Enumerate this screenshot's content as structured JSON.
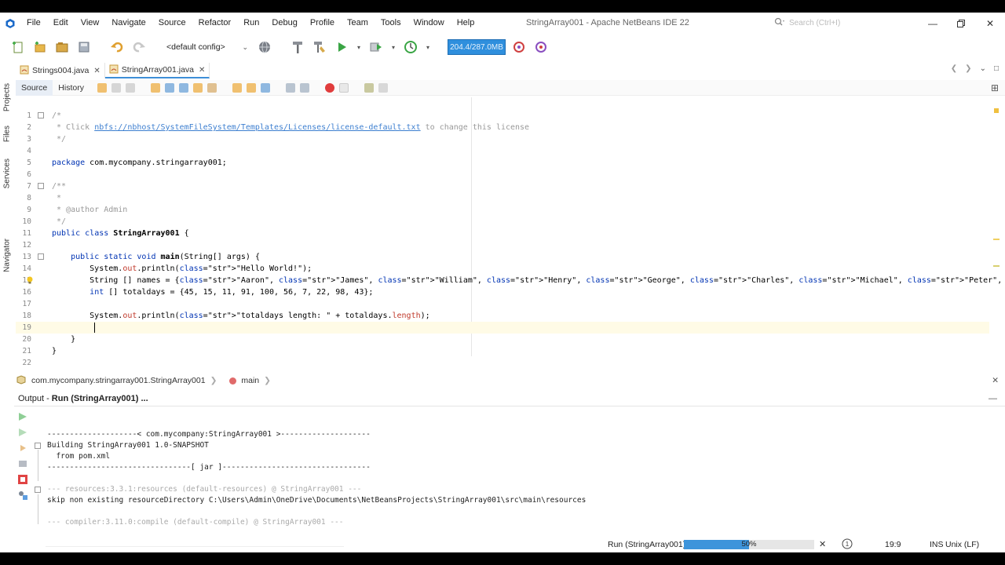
{
  "window": {
    "title": "StringArray001 - Apache NetBeans IDE 22"
  },
  "menu": [
    "File",
    "Edit",
    "View",
    "Navigate",
    "Source",
    "Refactor",
    "Run",
    "Debug",
    "Profile",
    "Team",
    "Tools",
    "Window",
    "Help"
  ],
  "search": {
    "placeholder": "Search (Ctrl+I)"
  },
  "toolbar": {
    "config": "<default config>",
    "memory": "204.4/287.0MB"
  },
  "side_panels": [
    "Projects",
    "Files",
    "Services",
    "Navigator"
  ],
  "tabs": [
    {
      "label": "Strings004.java",
      "active": false
    },
    {
      "label": "StringArray001.java",
      "active": true
    }
  ],
  "source_bar": {
    "source": "Source",
    "history": "History"
  },
  "code": [
    {
      "n": "1",
      "t": "/*"
    },
    {
      "n": "2",
      "t": " * Click nbfs://nbhost/SystemFileSystem/Templates/Licenses/license-default.txt to change this license"
    },
    {
      "n": "3",
      "t": " */"
    },
    {
      "n": "4",
      "t": ""
    },
    {
      "n": "5",
      "t": "package com.mycompany.stringarray001;"
    },
    {
      "n": "6",
      "t": ""
    },
    {
      "n": "7",
      "t": "/**"
    },
    {
      "n": "8",
      "t": " *"
    },
    {
      "n": "9",
      "t": " * @author Admin"
    },
    {
      "n": "10",
      "t": " */"
    },
    {
      "n": "11",
      "t": "public class StringArray001 {"
    },
    {
      "n": "12",
      "t": ""
    },
    {
      "n": "13",
      "t": "    public static void main(String[] args) {"
    },
    {
      "n": "14",
      "t": "        System.out.println(\"Hello World!\");"
    },
    {
      "n": "15",
      "t": "        String [] names = {\"Aaron\", \"James\", \"William\", \"Henry\", \"George\", \"Charles\", \"Michael\", \"Peter\", \"Victor\", \"Ian\"};"
    },
    {
      "n": "16",
      "t": "        int [] totaldays = {45, 15, 11, 91, 100, 56, 7, 22, 98, 43};"
    },
    {
      "n": "17",
      "t": ""
    },
    {
      "n": "18",
      "t": "        System.out.println(\"totaldays length: \" + totaldays.length);"
    },
    {
      "n": "19",
      "t": "        "
    },
    {
      "n": "20",
      "t": "    }"
    },
    {
      "n": "21",
      "t": "}"
    },
    {
      "n": "22",
      "t": ""
    }
  ],
  "breadcrumb": {
    "class_path": "com.mycompany.stringarray001.StringArray001",
    "method": "main"
  },
  "output": {
    "title_prefix": "Output - ",
    "title_bold": "Run (StringArray001) ...",
    "lines": [
      {
        "t": "--------------------< com.mycompany:StringArray001 >--------------------",
        "faded": false
      },
      {
        "t": "Building StringArray001 1.0-SNAPSHOT",
        "faded": false
      },
      {
        "t": "  from pom.xml",
        "faded": false
      },
      {
        "t": "--------------------------------[ jar ]---------------------------------",
        "faded": false
      },
      {
        "t": "",
        "faded": false
      },
      {
        "t": "--- resources:3.3.1:resources (default-resources) @ StringArray001 ---",
        "faded": true
      },
      {
        "t": "skip non existing resourceDirectory C:\\Users\\Admin\\OneDrive\\Documents\\NetBeansProjects\\StringArray001\\src\\main\\resources",
        "faded": false
      },
      {
        "t": "",
        "faded": false
      },
      {
        "t": "--- compiler:3.11.0:compile (default-compile) @ StringArray001 ---",
        "faded": true
      }
    ]
  },
  "status": {
    "task": "Run (StringArray001)",
    "progress_percent": 50,
    "progress_label": "50%",
    "position": "19:9",
    "mode": "INS",
    "line_ending": "Unix (LF)"
  },
  "colors": {
    "accent": "#3d94db",
    "keyword": "#0033b3",
    "string": "#b5760a",
    "comment": "#999999"
  }
}
